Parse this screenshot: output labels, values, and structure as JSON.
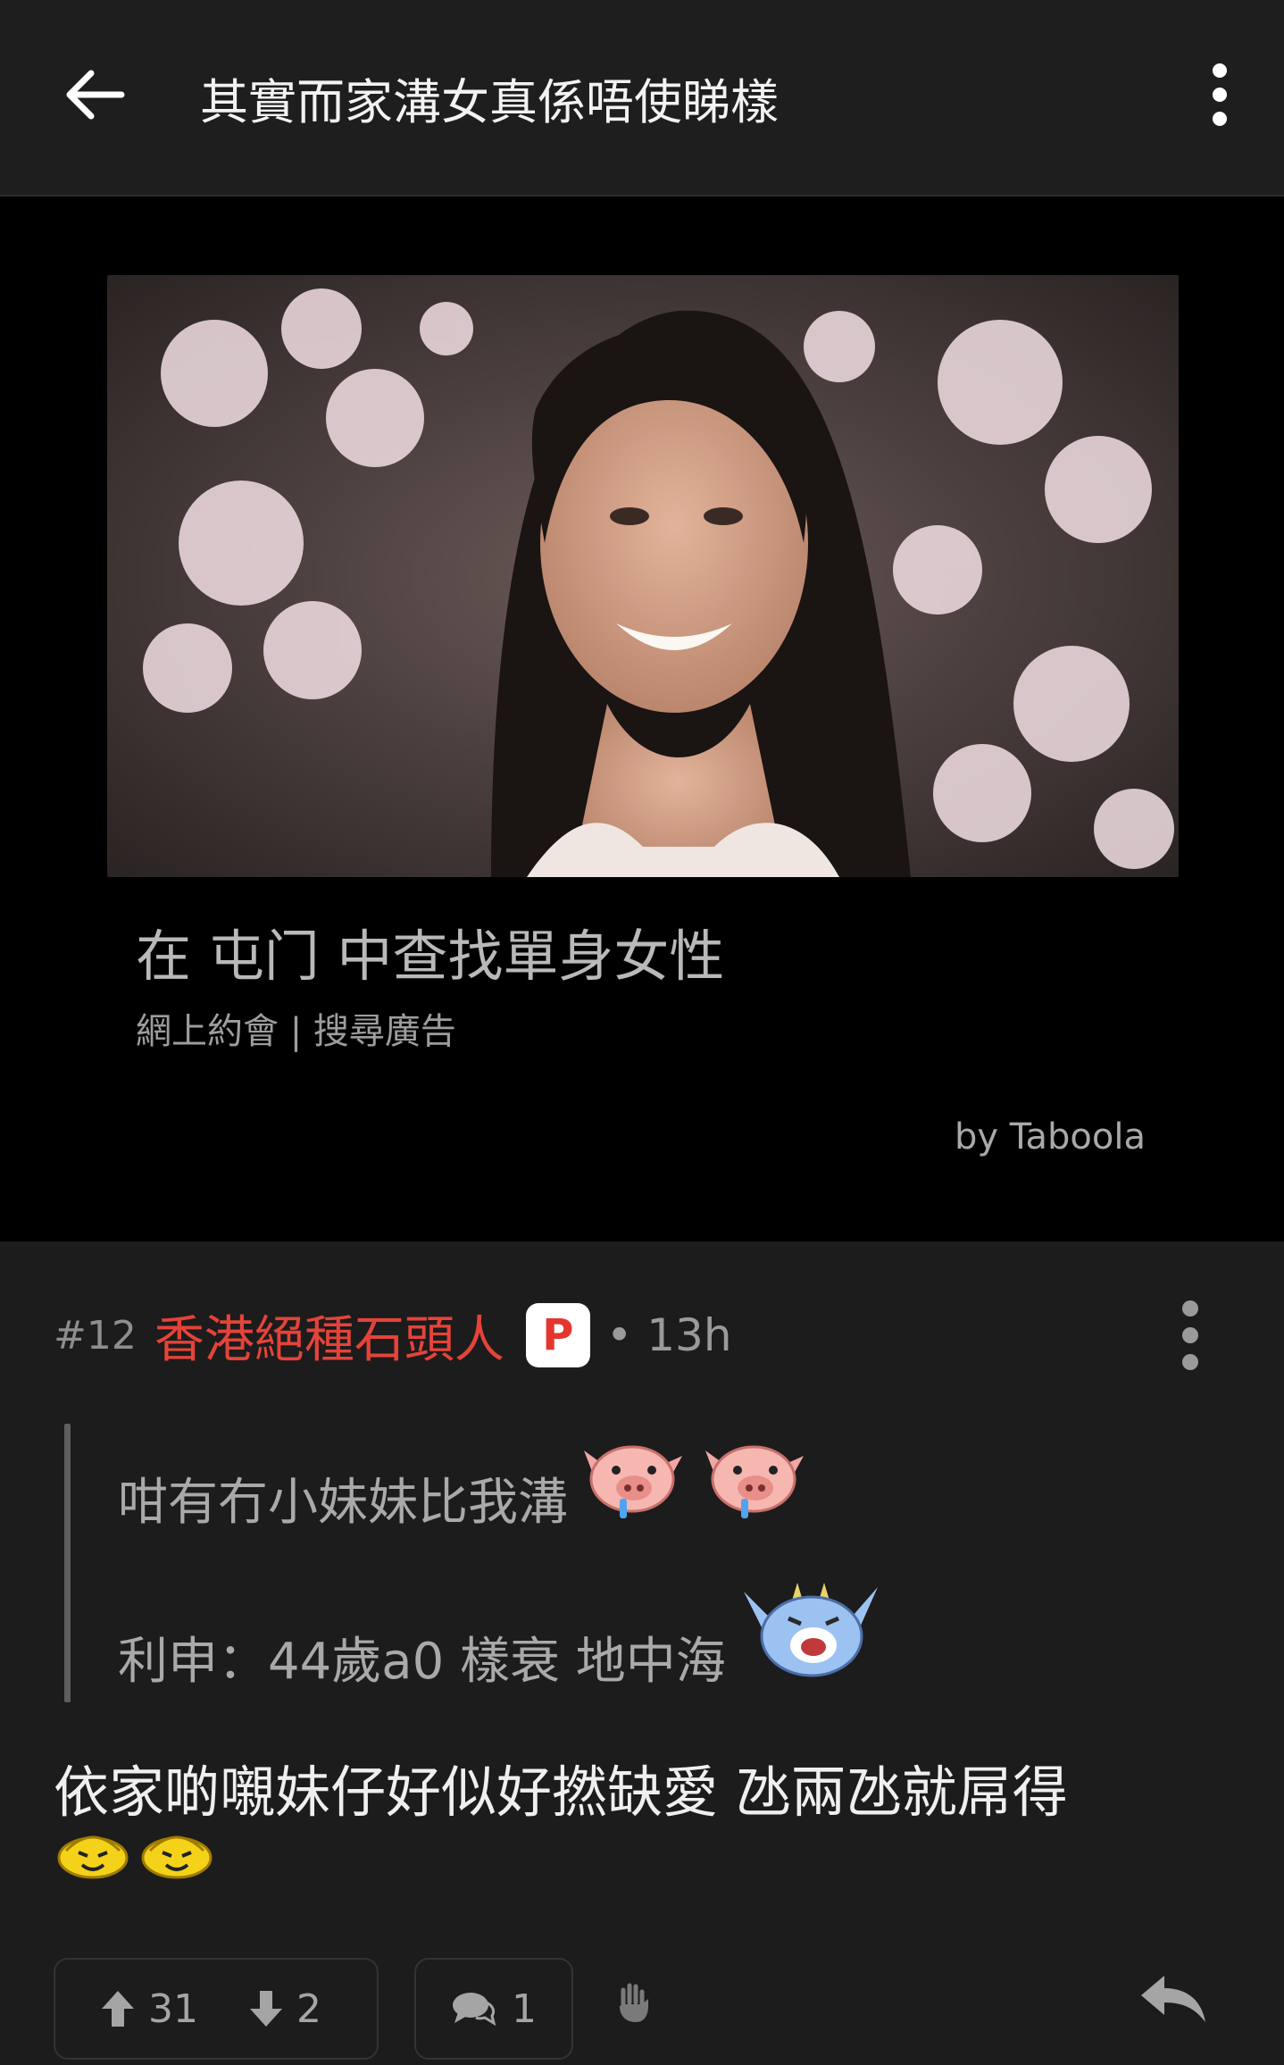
{
  "header": {
    "title": "其實而家溝女真係唔使睇樣"
  },
  "ad": {
    "title": "在 屯门 中查找單身女性",
    "subtitle": "網上約會 | 搜尋廣告",
    "attribution": "by Taboola"
  },
  "post": {
    "number": "#12",
    "username": "香港絕種石頭人",
    "badge": "P",
    "time": "• 13h",
    "quote": {
      "line1": "咁有冇小妹妹比我溝",
      "line2": "利申：44歲a0 樣衰 地中海"
    },
    "body": "依家啲嚫妹仔好似好撚缺愛 氹兩氹就屌得",
    "upvotes": "31",
    "downvotes": "2",
    "comments": "1"
  },
  "colors": {
    "username": "#e5433a",
    "background": "#1c1c1c",
    "ad_background": "#000000"
  },
  "icons": [
    "back-arrow-icon",
    "more-vertical-icon",
    "pig-drool-emoji",
    "blue-monster-emoji",
    "yellow-face-emoji",
    "upvote-arrow-icon",
    "downvote-arrow-icon",
    "comment-icon",
    "raised-hand-icon",
    "reply-icon"
  ]
}
